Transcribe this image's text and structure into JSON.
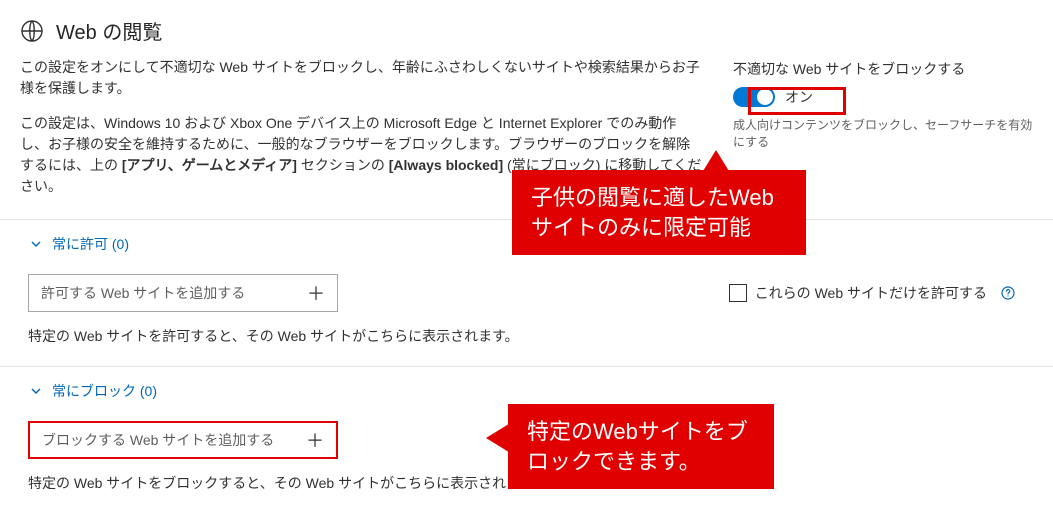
{
  "header": {
    "title": "Web の閲覧"
  },
  "description": {
    "para1": "この設定をオンにして不適切な Web サイトをブロックし、年齢にふさわしくないサイトや検索結果からお子様を保護します。",
    "para2_a": "この設定は、Windows 10 および Xbox One デバイス上の Microsoft Edge と Internet Explorer でのみ動作し、お子様の安全を維持するために、一般的なブラウザーをブロックします。ブラウザーのブロックを解除するには、上の ",
    "para2_bold1": "[アプリ、ゲームとメディア]",
    "para2_b": " セクションの ",
    "para2_bold2": "[Always blocked]",
    "para2_c": " (常にブロック) に移動してください。"
  },
  "toggle": {
    "label": "不適切な Web サイトをブロックする",
    "state": "オン",
    "hint": "成人向けコンテンツをブロックし、セーフサーチを有効にする"
  },
  "allow": {
    "header": "常に許可 (0)",
    "placeholder": "許可する Web サイトを追加する",
    "desc": "特定の Web サイトを許可すると、その Web サイトがこちらに表示されます。",
    "checkbox_label": "これらの Web サイトだけを許可する"
  },
  "block": {
    "header": "常にブロック (0)",
    "placeholder": "ブロックする Web サイトを追加する",
    "desc": "特定の Web サイトをブロックすると、その Web サイトがこちらに表示されます。"
  },
  "annotations": {
    "callout1": "子供の閲覧に適したWebサイトのみに限定可能",
    "callout2": "特定のWebサイトをブロックできます。"
  }
}
